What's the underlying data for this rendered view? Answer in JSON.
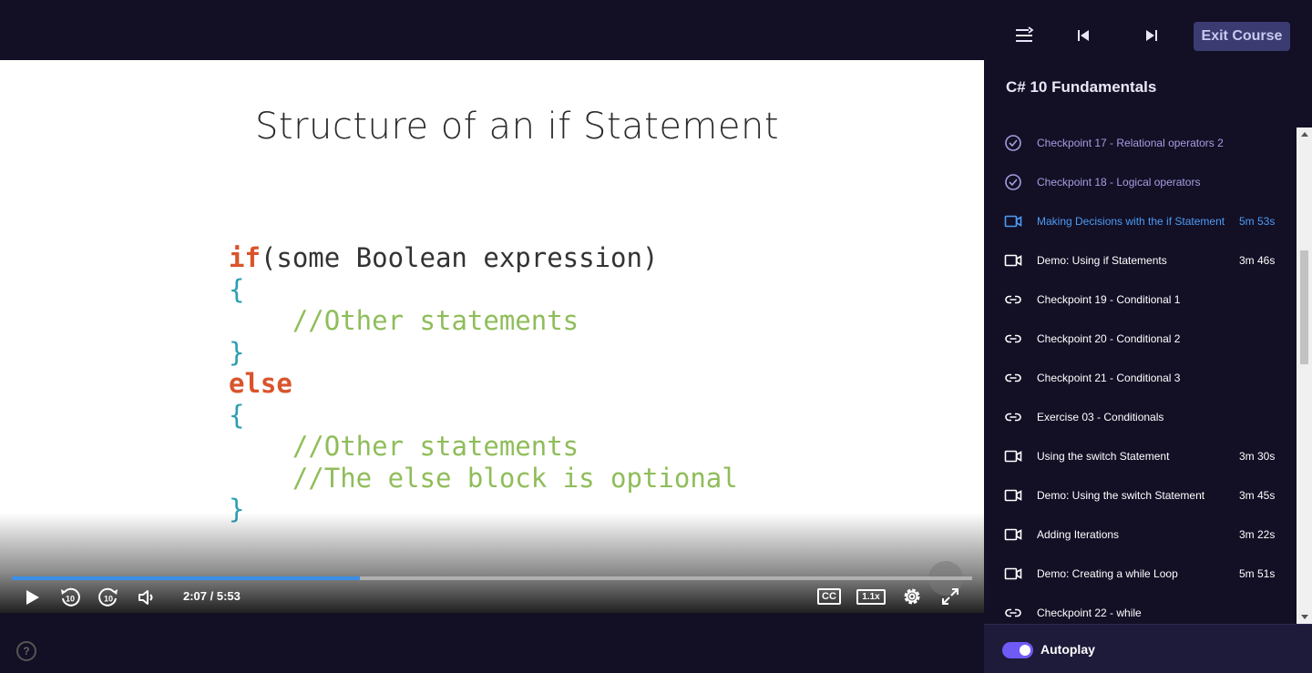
{
  "slide": {
    "title": "Structure of an if Statement",
    "code": {
      "if_kw": "if",
      "condition": "(some Boolean expression)",
      "open1": "{",
      "comment1": "//Other statements",
      "close1": "}",
      "else_kw": "else",
      "open2": "{",
      "comment2": "//Other statements",
      "comment3": "//The else block is optional",
      "close2": "}"
    }
  },
  "player": {
    "time": "2:07 / 5:53",
    "progress_fraction": 0.362,
    "cc_label": "CC",
    "speed_label": "1.1x",
    "help_label": "?"
  },
  "sidebar": {
    "exit_label": "Exit Course",
    "course_title": "C# 10 Fundamentals",
    "items": [
      {
        "label": "Checkpoint 17 - Relational operators 2",
        "duration": "",
        "icon": "check-circle-icon",
        "state": "done"
      },
      {
        "label": "Checkpoint 18 - Logical operators",
        "duration": "",
        "icon": "check-circle-icon",
        "state": "done"
      },
      {
        "label": "Making Decisions with the if Statement",
        "duration": "5m 53s",
        "icon": "video-icon",
        "state": "active"
      },
      {
        "label": "Demo: Using if Statements",
        "duration": "3m 46s",
        "icon": "video-icon",
        "state": ""
      },
      {
        "label": "Checkpoint 19 - Conditional 1",
        "duration": "",
        "icon": "link-icon",
        "state": ""
      },
      {
        "label": "Checkpoint 20 - Conditional 2",
        "duration": "",
        "icon": "link-icon",
        "state": ""
      },
      {
        "label": "Checkpoint 21 - Conditional 3",
        "duration": "",
        "icon": "link-icon",
        "state": ""
      },
      {
        "label": "Exercise 03 - Conditionals",
        "duration": "",
        "icon": "link-icon",
        "state": ""
      },
      {
        "label": "Using the switch Statement",
        "duration": "3m 30s",
        "icon": "video-icon",
        "state": ""
      },
      {
        "label": "Demo: Using the switch Statement",
        "duration": "3m 45s",
        "icon": "video-icon",
        "state": ""
      },
      {
        "label": "Adding Iterations",
        "duration": "3m 22s",
        "icon": "video-icon",
        "state": ""
      },
      {
        "label": "Demo: Creating a while Loop",
        "duration": "5m 51s",
        "icon": "video-icon",
        "state": ""
      },
      {
        "label": "Checkpoint 22 - while",
        "duration": "",
        "icon": "link-icon",
        "state": ""
      }
    ],
    "autoplay_label": "Autoplay",
    "autoplay_on": true
  },
  "colors": {
    "background": "#130f25",
    "accent": "#3b8ee8",
    "done_text": "#a49fe0",
    "active_text": "#4c9cf3",
    "toggle": "#6e5bf5"
  }
}
